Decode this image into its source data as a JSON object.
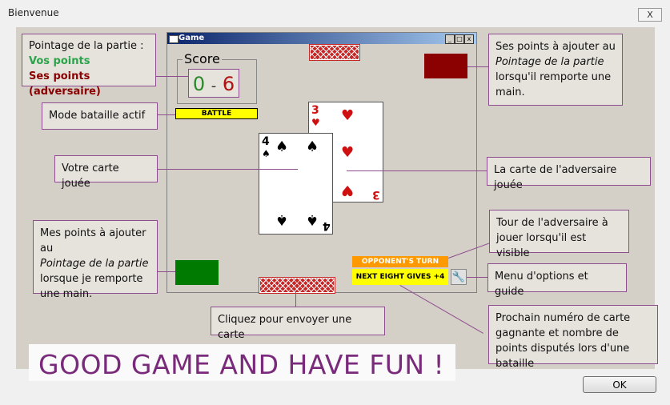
{
  "window": {
    "title": "Bienvenue",
    "close": "X",
    "ok": "OK"
  },
  "game": {
    "title": "Game",
    "min": "_",
    "max": "□",
    "close": "x"
  },
  "score": {
    "label": "Score",
    "mine": "0",
    "sep": "-",
    "theirs": "6"
  },
  "battle_label": "BATTLE",
  "opponent_turn": "OPPONENT'S TURN",
  "next_eight": "NEXT EIGHT GIVES +4",
  "cards": {
    "mine": {
      "rank": "4",
      "suit": "♠"
    },
    "opponent": {
      "rank": "3",
      "suit": "♥"
    }
  },
  "annotations": {
    "pointage_title": "Pointage de la partie :",
    "vos_points": "Vos points",
    "ses_points": "Ses points (adversaire)",
    "ses_points_note_1": "Ses points à ajouter au",
    "ses_points_note_2": "Pointage de la partie",
    "ses_points_note_3": "lorsqu'il remporte une main.",
    "mode_bataille": "Mode bataille actif",
    "votre_carte": "Votre carte jouée",
    "carte_adversaire": "La carte de l'adversaire jouée",
    "mes_points_1": "Mes points à ajouter au",
    "mes_points_2": "Pointage de la partie",
    "mes_points_3": "lorsque je remporte une main.",
    "tour_adversaire": "Tour de l'adversaire à jouer lorsqu'il est visible",
    "menu_options": "Menu d'options et guide",
    "cliquez": "Cliquez pour envoyer une carte",
    "prochain": "Prochain numéro de carte gagnante et nombre de points disputés lors d'une bataille"
  },
  "banner": "GOOD GAME AND HAVE FUN !",
  "colors": {
    "vos_points": "#2aa44a",
    "ses_points": "#8b0000",
    "my_pile": "#007a00",
    "opp_pile": "#8b0000",
    "accent": "#8e4d8e"
  }
}
